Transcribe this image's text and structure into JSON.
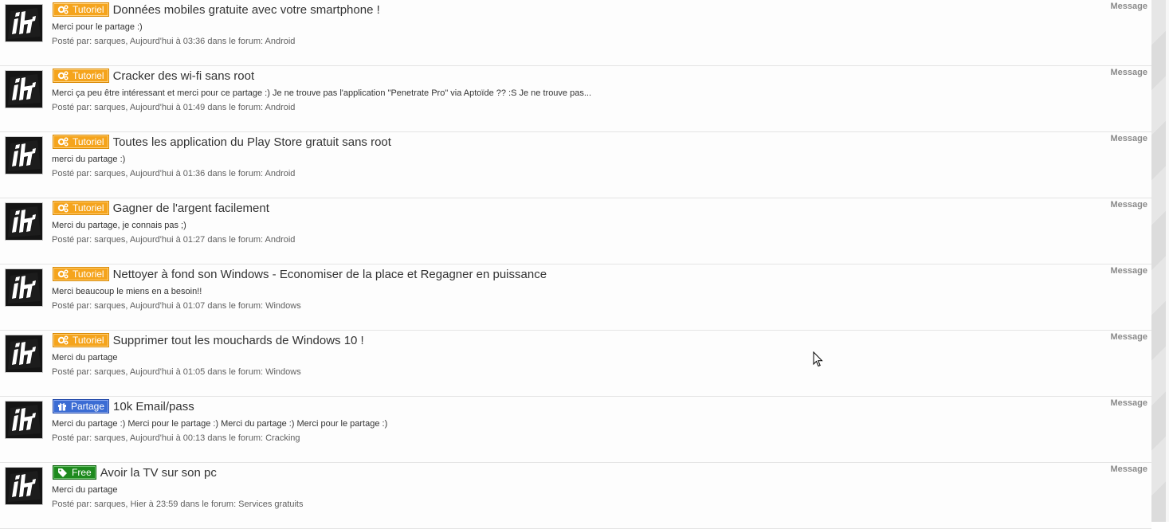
{
  "results": [
    {
      "badge": "Tutoriel",
      "badge_type": "tutoriel",
      "title": "Données mobiles gratuite avec votre smartphone !",
      "excerpt": "Merci pour le partage :)",
      "meta": "Posté par: sarques, Aujourd'hui à 03:36 dans le forum: Android",
      "type": "Message"
    },
    {
      "badge": "Tutoriel",
      "badge_type": "tutoriel",
      "title": "Cracker des wi-fi sans root",
      "excerpt": "Merci ça peu être intéressant et merci pour ce partage :) Je ne trouve pas l'application \"Penetrate Pro\" via Aptoïde ?? :S Je ne trouve pas...",
      "meta": "Posté par: sarques, Aujourd'hui à 01:49 dans le forum: Android",
      "type": "Message"
    },
    {
      "badge": "Tutoriel",
      "badge_type": "tutoriel",
      "title": "Toutes les application du Play Store gratuit sans root",
      "excerpt": "merci du partage :)",
      "meta": "Posté par: sarques, Aujourd'hui à 01:36 dans le forum: Android",
      "type": "Message"
    },
    {
      "badge": "Tutoriel",
      "badge_type": "tutoriel",
      "title": "Gagner de l'argent facilement",
      "excerpt": "Merci du partage, je connais pas ;)",
      "meta": "Posté par: sarques, Aujourd'hui à 01:27 dans le forum: Android",
      "type": "Message"
    },
    {
      "badge": "Tutoriel",
      "badge_type": "tutoriel",
      "title": "Nettoyer à fond son Windows - Economiser de la place et Regagner en puissance",
      "excerpt": "Merci beaucoup le miens en a besoin!!",
      "meta": "Posté par: sarques, Aujourd'hui à 01:07 dans le forum: Windows",
      "type": "Message"
    },
    {
      "badge": "Tutoriel",
      "badge_type": "tutoriel",
      "title": "Supprimer tout les mouchards de Windows 10 !",
      "excerpt": "Merci du partage",
      "meta": "Posté par: sarques, Aujourd'hui à 01:05 dans le forum: Windows",
      "type": "Message"
    },
    {
      "badge": "Partage",
      "badge_type": "partage",
      "title": "10k Email/pass",
      "excerpt": "Merci du partage :) Merci pour le partage :) Merci du partage :) Merci pour le partage :)",
      "meta": "Posté par: sarques, Aujourd'hui à 00:13 dans le forum: Cracking",
      "type": "Message"
    },
    {
      "badge": "Free",
      "badge_type": "free",
      "title": "Avoir la TV sur son pc",
      "excerpt": "Merci du partage",
      "meta": "Posté par: sarques, Hier à 23:59 dans le forum: Services gratuits",
      "type": "Message"
    }
  ],
  "icons": {
    "tutoriel": "gears-icon",
    "partage": "gift-icon",
    "free": "tag-icon",
    "avatar": "user-avatar"
  },
  "colors": {
    "tutoriel": "#f5a41c",
    "partage": "#3b6cd4",
    "free": "#1e8a1e"
  }
}
